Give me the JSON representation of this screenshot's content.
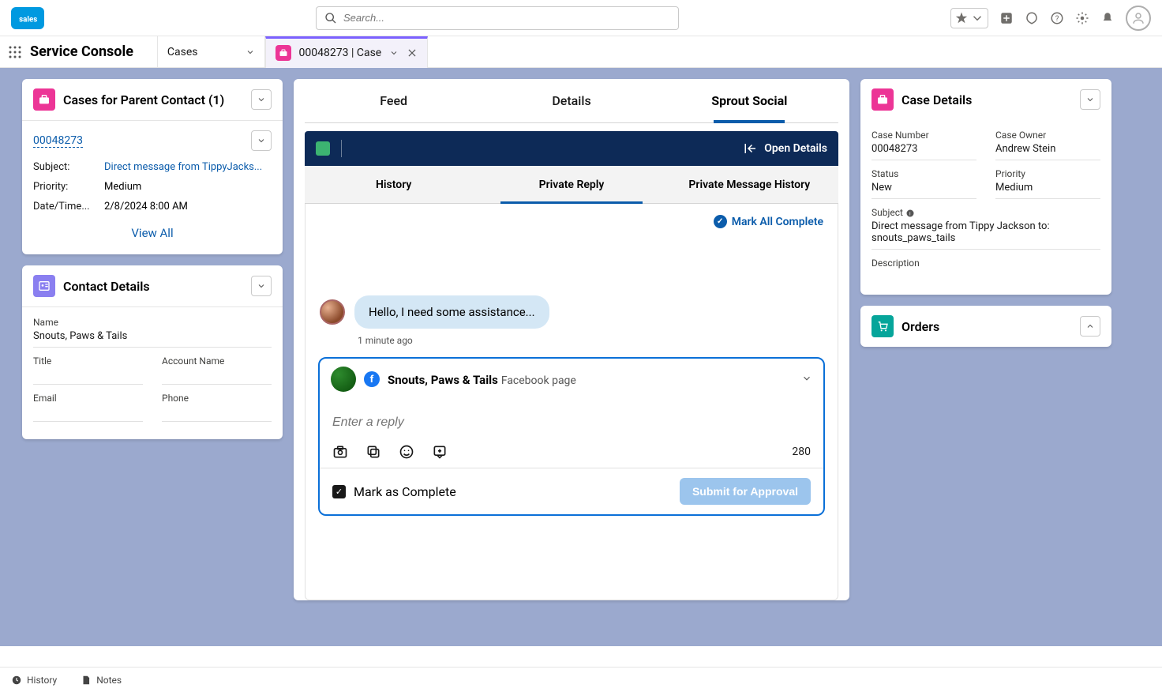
{
  "header": {
    "search_placeholder": "Search..."
  },
  "context": {
    "app_name": "Service Console",
    "nav_item": "Cases",
    "active_tab": "00048273 | Case"
  },
  "left": {
    "cases_title": "Cases for Parent Contact (1)",
    "case_number_link": "00048273",
    "subject_lbl": "Subject:",
    "subject_val": "Direct message from TippyJacks...",
    "priority_lbl": "Priority:",
    "priority_val": "Medium",
    "datetime_lbl": "Date/Time...",
    "datetime_val": "2/8/2024 8:00 AM",
    "view_all": "View All",
    "contact_title": "Contact Details",
    "name_lbl": "Name",
    "name_val": "Snouts, Paws & Tails",
    "title_lbl": "Title",
    "account_lbl": "Account Name",
    "email_lbl": "Email",
    "phone_lbl": "Phone"
  },
  "center": {
    "tabs": {
      "feed": "Feed",
      "details": "Details",
      "sprout": "Sprout Social"
    },
    "open_details": "Open Details",
    "subtabs": {
      "history": "History",
      "private_reply": "Private Reply",
      "pm_history": "Private Message History"
    },
    "mark_all": "Mark All Complete",
    "message_text": "Hello, I need some assistance...",
    "message_time": "1 minute ago",
    "reply_from_name": "Snouts, Paws & Tails",
    "reply_from_sub": "Facebook page",
    "reply_placeholder": "Enter a reply",
    "char_count": "280",
    "mark_complete": "Mark as Complete",
    "submit": "Submit for Approval"
  },
  "right": {
    "case_details_title": "Case Details",
    "case_number_lbl": "Case Number",
    "case_number_val": "00048273",
    "owner_lbl": "Case Owner",
    "owner_val": "Andrew Stein",
    "status_lbl": "Status",
    "status_val": "New",
    "priority_lbl": "Priority",
    "priority_val": "Medium",
    "subject_lbl": "Subject",
    "subject_val": "Direct message from Tippy Jackson to: snouts_paws_tails",
    "description_lbl": "Description",
    "orders_title": "Orders"
  },
  "bottom": {
    "history": "History",
    "notes": "Notes"
  }
}
